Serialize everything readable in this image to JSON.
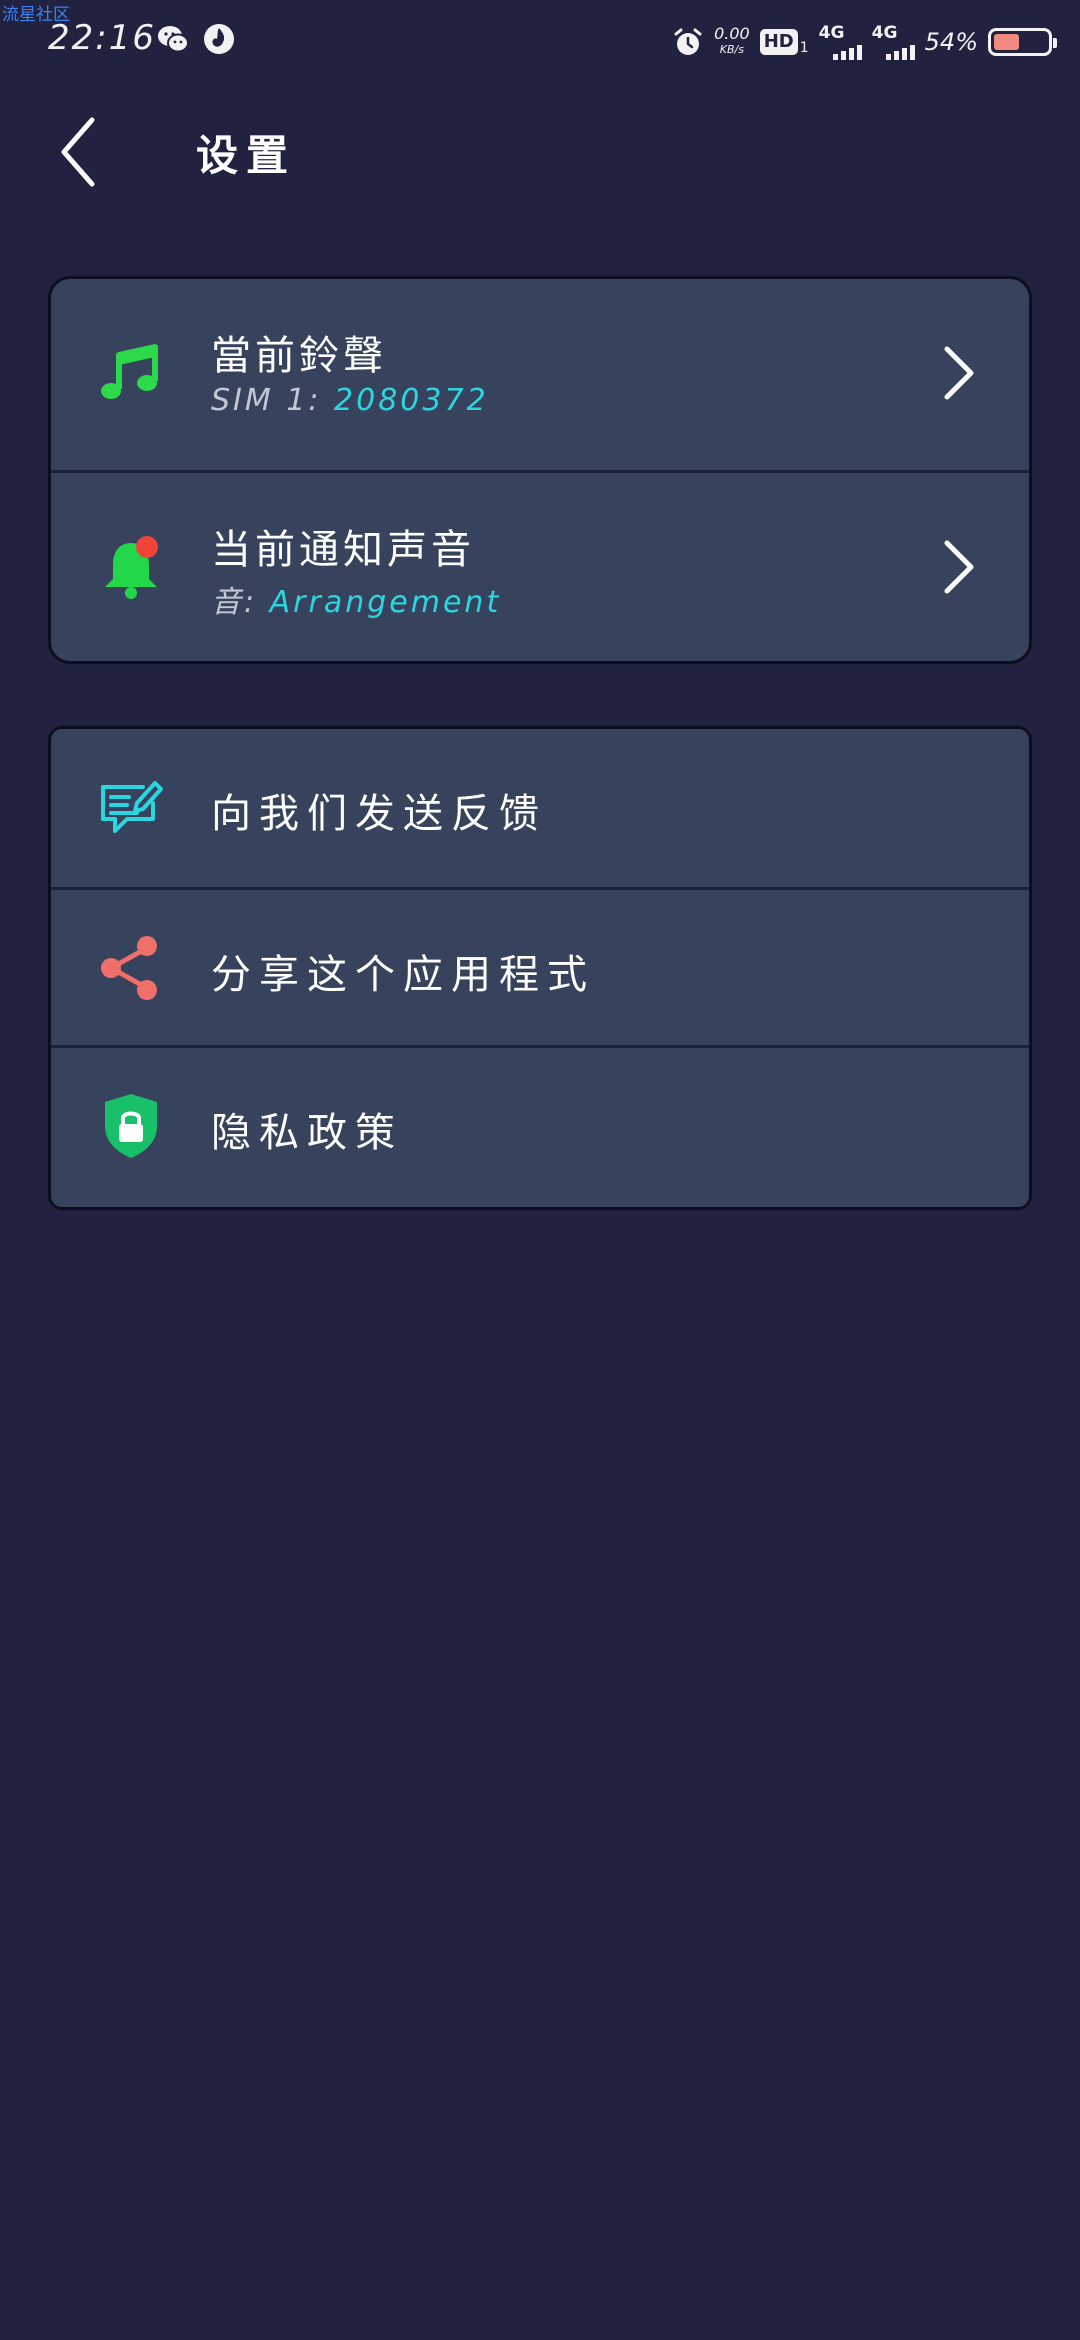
{
  "watermark": "流星社区",
  "status_bar": {
    "time": "22:16",
    "net_speed": "0.00",
    "net_unit": "KB/s",
    "hd_label": "HD",
    "hd_sub": "1",
    "sim1_type": "4G",
    "sim2_type": "4G",
    "battery_text": "54%",
    "battery_level": 0.54,
    "left_icons": [
      "wechat-icon",
      "app-notification-icon"
    ],
    "right_icons": [
      "alarm-clock-icon"
    ]
  },
  "header": {
    "title": "设置",
    "back_icon": "chevron-left-icon"
  },
  "sound_settings": [
    {
      "icon": "music-note-icon",
      "title": "當前鈴聲",
      "sub_label": "SIM 1: ",
      "sub_value": "2080372",
      "chevron": "chevron-right-icon"
    },
    {
      "icon": "bell-notification-icon",
      "title": "当前通知声音",
      "sub_label": "音:  ",
      "sub_value": "Arrangement",
      "chevron": "chevron-right-icon"
    }
  ],
  "other_settings": [
    {
      "icon": "feedback-edit-icon",
      "title": "向我们发送反馈"
    },
    {
      "icon": "share-icon",
      "title": "分享这个应用程式"
    },
    {
      "icon": "shield-lock-icon",
      "title": "隐私政策"
    }
  ],
  "colors": {
    "background": "#202240",
    "card": "#37435c",
    "accent_cyan": "#2ad7e0",
    "music_green": "#2bd94a",
    "bell_green": "#22d84a",
    "bell_dot_red": "#f04438",
    "share_coral": "#ef6f6a",
    "shield_green": "#19c06a"
  }
}
